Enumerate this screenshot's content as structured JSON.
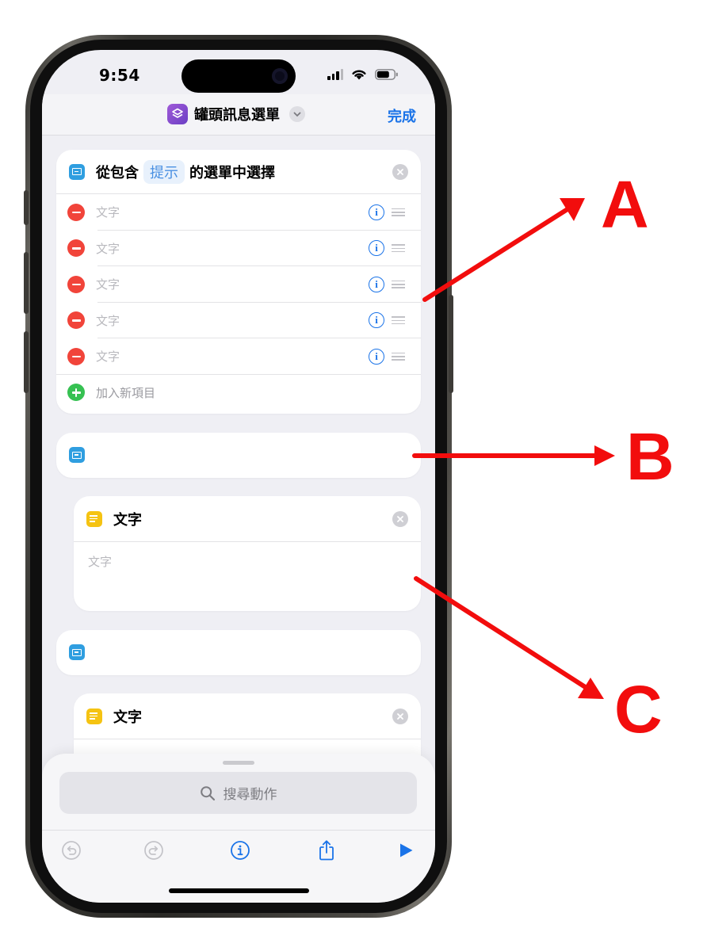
{
  "status_bar": {
    "time": "9:54"
  },
  "nav": {
    "title": "罐頭訊息選單",
    "done_label": "完成"
  },
  "choose_menu": {
    "prefix": "從包含",
    "prompt_token": "提示",
    "suffix": "的選單中選擇",
    "items": [
      "文字",
      "文字",
      "文字",
      "文字",
      "文字"
    ],
    "add_item_label": "加入新項目"
  },
  "text_action_1": {
    "title": "文字",
    "placeholder": "文字"
  },
  "text_action_2": {
    "title": "文字"
  },
  "bottom_sheet": {
    "search_placeholder": "搜尋動作"
  },
  "annotations": [
    "A",
    "B",
    "C"
  ],
  "colors": {
    "accent": "#1a73e8",
    "annotation": "#f20d0d",
    "remove": "#f1443a",
    "add": "#36c152",
    "menu_icon": "#2f9ee0",
    "text_icon": "#f5c312"
  }
}
